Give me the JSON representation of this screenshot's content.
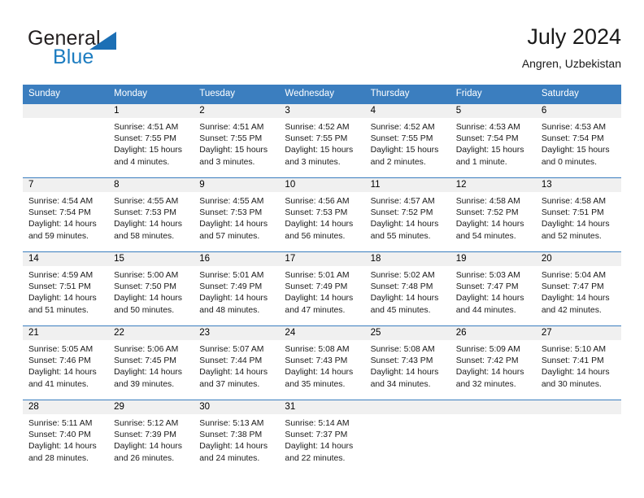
{
  "brand": {
    "name_part1": "General",
    "name_part2": "Blue",
    "logo_icon": "triangle-logo-icon"
  },
  "header": {
    "title": "July 2024",
    "location": "Angren, Uzbekistan"
  },
  "calendar": {
    "weekday_headers": [
      "Sunday",
      "Monday",
      "Tuesday",
      "Wednesday",
      "Thursday",
      "Friday",
      "Saturday"
    ],
    "header_bg": "#3b7ebf",
    "daynum_bg": "#f0f0f0",
    "weeks": [
      [
        {
          "day": "",
          "lines": []
        },
        {
          "day": "1",
          "lines": [
            "Sunrise: 4:51 AM",
            "Sunset: 7:55 PM",
            "Daylight: 15 hours",
            "and 4 minutes."
          ]
        },
        {
          "day": "2",
          "lines": [
            "Sunrise: 4:51 AM",
            "Sunset: 7:55 PM",
            "Daylight: 15 hours",
            "and 3 minutes."
          ]
        },
        {
          "day": "3",
          "lines": [
            "Sunrise: 4:52 AM",
            "Sunset: 7:55 PM",
            "Daylight: 15 hours",
            "and 3 minutes."
          ]
        },
        {
          "day": "4",
          "lines": [
            "Sunrise: 4:52 AM",
            "Sunset: 7:55 PM",
            "Daylight: 15 hours",
            "and 2 minutes."
          ]
        },
        {
          "day": "5",
          "lines": [
            "Sunrise: 4:53 AM",
            "Sunset: 7:54 PM",
            "Daylight: 15 hours",
            "and 1 minute."
          ]
        },
        {
          "day": "6",
          "lines": [
            "Sunrise: 4:53 AM",
            "Sunset: 7:54 PM",
            "Daylight: 15 hours",
            "and 0 minutes."
          ]
        }
      ],
      [
        {
          "day": "7",
          "lines": [
            "Sunrise: 4:54 AM",
            "Sunset: 7:54 PM",
            "Daylight: 14 hours",
            "and 59 minutes."
          ]
        },
        {
          "day": "8",
          "lines": [
            "Sunrise: 4:55 AM",
            "Sunset: 7:53 PM",
            "Daylight: 14 hours",
            "and 58 minutes."
          ]
        },
        {
          "day": "9",
          "lines": [
            "Sunrise: 4:55 AM",
            "Sunset: 7:53 PM",
            "Daylight: 14 hours",
            "and 57 minutes."
          ]
        },
        {
          "day": "10",
          "lines": [
            "Sunrise: 4:56 AM",
            "Sunset: 7:53 PM",
            "Daylight: 14 hours",
            "and 56 minutes."
          ]
        },
        {
          "day": "11",
          "lines": [
            "Sunrise: 4:57 AM",
            "Sunset: 7:52 PM",
            "Daylight: 14 hours",
            "and 55 minutes."
          ]
        },
        {
          "day": "12",
          "lines": [
            "Sunrise: 4:58 AM",
            "Sunset: 7:52 PM",
            "Daylight: 14 hours",
            "and 54 minutes."
          ]
        },
        {
          "day": "13",
          "lines": [
            "Sunrise: 4:58 AM",
            "Sunset: 7:51 PM",
            "Daylight: 14 hours",
            "and 52 minutes."
          ]
        }
      ],
      [
        {
          "day": "14",
          "lines": [
            "Sunrise: 4:59 AM",
            "Sunset: 7:51 PM",
            "Daylight: 14 hours",
            "and 51 minutes."
          ]
        },
        {
          "day": "15",
          "lines": [
            "Sunrise: 5:00 AM",
            "Sunset: 7:50 PM",
            "Daylight: 14 hours",
            "and 50 minutes."
          ]
        },
        {
          "day": "16",
          "lines": [
            "Sunrise: 5:01 AM",
            "Sunset: 7:49 PM",
            "Daylight: 14 hours",
            "and 48 minutes."
          ]
        },
        {
          "day": "17",
          "lines": [
            "Sunrise: 5:01 AM",
            "Sunset: 7:49 PM",
            "Daylight: 14 hours",
            "and 47 minutes."
          ]
        },
        {
          "day": "18",
          "lines": [
            "Sunrise: 5:02 AM",
            "Sunset: 7:48 PM",
            "Daylight: 14 hours",
            "and 45 minutes."
          ]
        },
        {
          "day": "19",
          "lines": [
            "Sunrise: 5:03 AM",
            "Sunset: 7:47 PM",
            "Daylight: 14 hours",
            "and 44 minutes."
          ]
        },
        {
          "day": "20",
          "lines": [
            "Sunrise: 5:04 AM",
            "Sunset: 7:47 PM",
            "Daylight: 14 hours",
            "and 42 minutes."
          ]
        }
      ],
      [
        {
          "day": "21",
          "lines": [
            "Sunrise: 5:05 AM",
            "Sunset: 7:46 PM",
            "Daylight: 14 hours",
            "and 41 minutes."
          ]
        },
        {
          "day": "22",
          "lines": [
            "Sunrise: 5:06 AM",
            "Sunset: 7:45 PM",
            "Daylight: 14 hours",
            "and 39 minutes."
          ]
        },
        {
          "day": "23",
          "lines": [
            "Sunrise: 5:07 AM",
            "Sunset: 7:44 PM",
            "Daylight: 14 hours",
            "and 37 minutes."
          ]
        },
        {
          "day": "24",
          "lines": [
            "Sunrise: 5:08 AM",
            "Sunset: 7:43 PM",
            "Daylight: 14 hours",
            "and 35 minutes."
          ]
        },
        {
          "day": "25",
          "lines": [
            "Sunrise: 5:08 AM",
            "Sunset: 7:43 PM",
            "Daylight: 14 hours",
            "and 34 minutes."
          ]
        },
        {
          "day": "26",
          "lines": [
            "Sunrise: 5:09 AM",
            "Sunset: 7:42 PM",
            "Daylight: 14 hours",
            "and 32 minutes."
          ]
        },
        {
          "day": "27",
          "lines": [
            "Sunrise: 5:10 AM",
            "Sunset: 7:41 PM",
            "Daylight: 14 hours",
            "and 30 minutes."
          ]
        }
      ],
      [
        {
          "day": "28",
          "lines": [
            "Sunrise: 5:11 AM",
            "Sunset: 7:40 PM",
            "Daylight: 14 hours",
            "and 28 minutes."
          ]
        },
        {
          "day": "29",
          "lines": [
            "Sunrise: 5:12 AM",
            "Sunset: 7:39 PM",
            "Daylight: 14 hours",
            "and 26 minutes."
          ]
        },
        {
          "day": "30",
          "lines": [
            "Sunrise: 5:13 AM",
            "Sunset: 7:38 PM",
            "Daylight: 14 hours",
            "and 24 minutes."
          ]
        },
        {
          "day": "31",
          "lines": [
            "Sunrise: 5:14 AM",
            "Sunset: 7:37 PM",
            "Daylight: 14 hours",
            "and 22 minutes."
          ]
        },
        {
          "day": "",
          "lines": []
        },
        {
          "day": "",
          "lines": []
        },
        {
          "day": "",
          "lines": []
        }
      ]
    ]
  }
}
